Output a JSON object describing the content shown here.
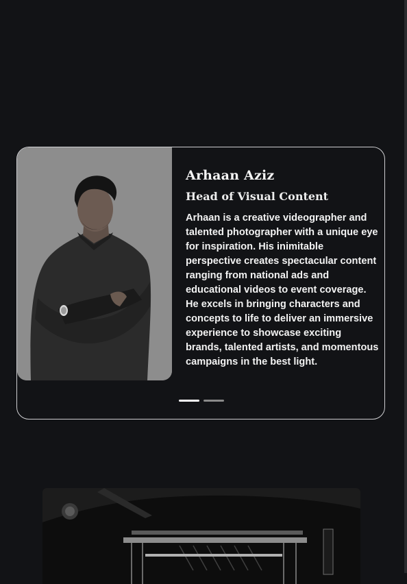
{
  "profile": {
    "name": "Arhaan Aziz",
    "role": "Head of Visual Content",
    "bio": "Arhaan is a creative videographer and talented photographer with a unique eye for inspiration. His inimitable perspective creates spectacular content ranging from national ads and educational videos to event coverage. He excels in bringing characters and concepts to life to deliver an immersive experience to showcase exciting brands, talented artists, and momentous campaigns in the best light."
  },
  "carousel": {
    "slides": 2,
    "active_index": 0
  },
  "colors": {
    "background": "#121316",
    "card_border": "#cfcfd2",
    "photo_background": "#8b8b8b",
    "dot_active": "#ffffff",
    "dot_inactive": "#8a8a8a"
  }
}
